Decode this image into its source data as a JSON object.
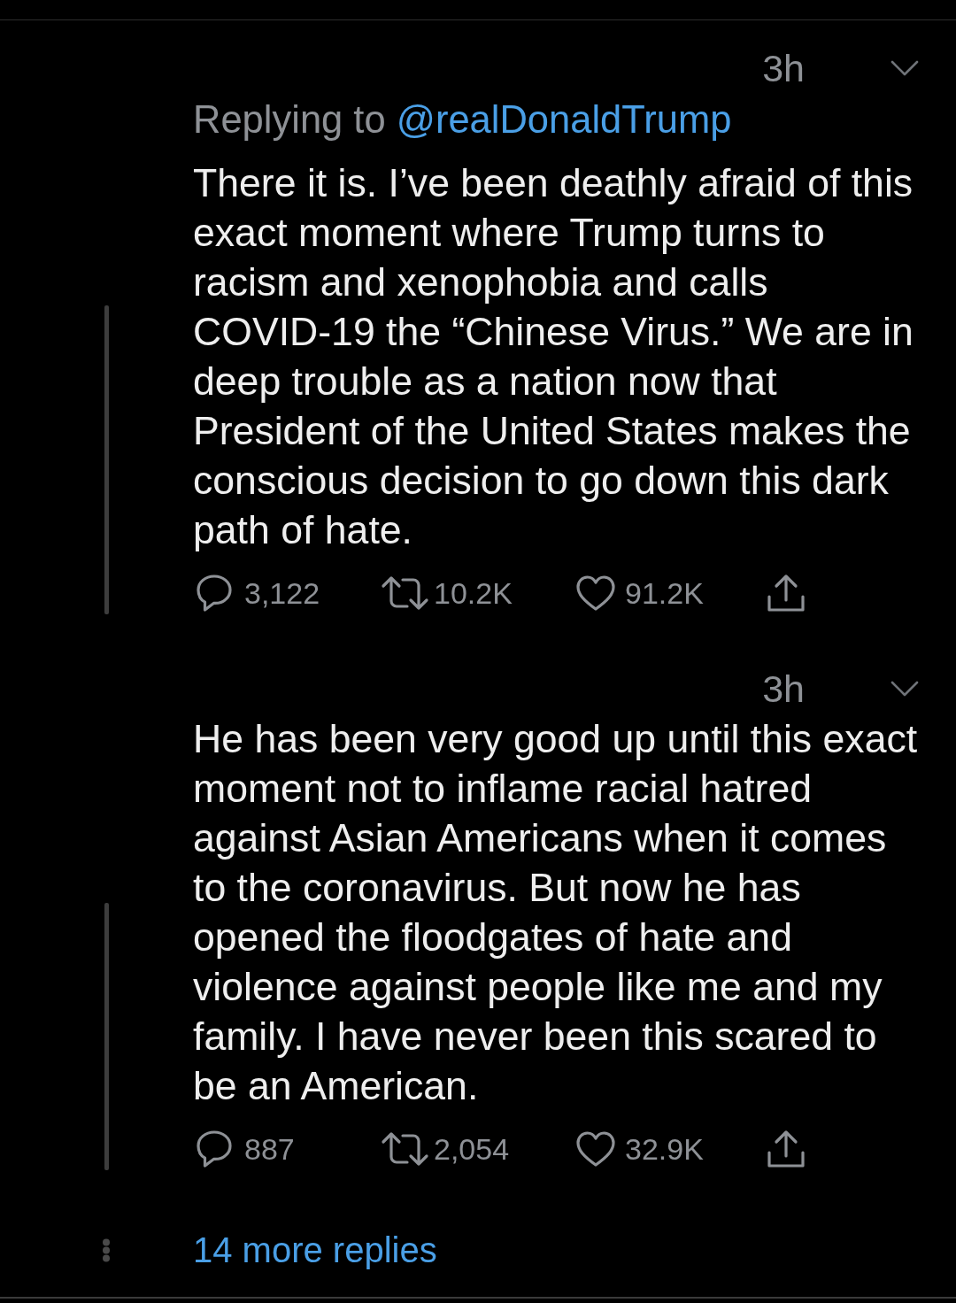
{
  "tweets": [
    {
      "time": "3h",
      "replying_to": {
        "label": "Replying to",
        "handle": "@realDonaldTrump"
      },
      "text": "There it is. I’ve been deathly afraid of this exact moment where Trump turns to racism and xenophobia and calls COVID-19 the “Chinese Virus.” We are in deep trouble as a nation now that President of the United States makes the conscious decision to go down this dark path of hate.",
      "actions": [
        {
          "kind": "reply",
          "count": "3,122"
        },
        {
          "kind": "retweet",
          "count": "10.2K"
        },
        {
          "kind": "like",
          "count": "91.2K"
        },
        {
          "kind": "share"
        }
      ]
    },
    {
      "time": "3h",
      "text": "He has been very good up until this exact moment not to inflame racial hatred against Asian Americans when it comes to the coronavirus. But now he has opened the floodgates of hate and violence against people like me and my family. I have never been this scared to be an American.",
      "actions": [
        {
          "kind": "reply",
          "count": "887"
        },
        {
          "kind": "retweet",
          "count": "2,054"
        },
        {
          "kind": "like",
          "count": "32.9K"
        },
        {
          "kind": "share"
        }
      ]
    }
  ],
  "more_replies": "14 more replies"
}
